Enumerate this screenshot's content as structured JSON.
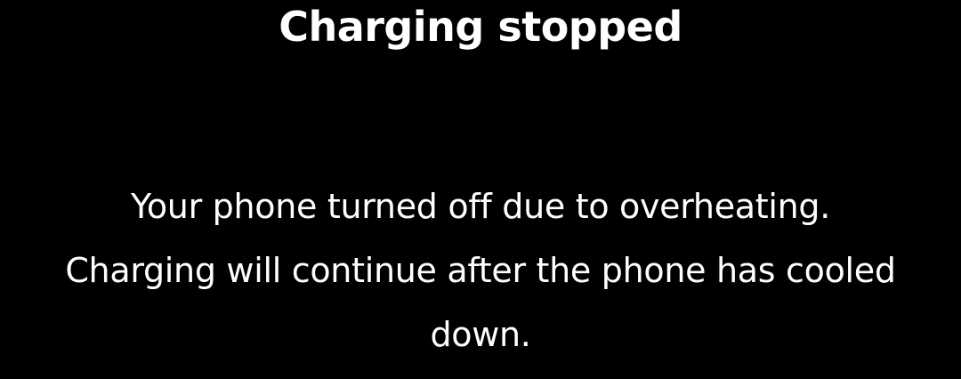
{
  "dialog": {
    "title": "Charging stopped",
    "message": "Your phone turned off due to overheating. Charging will continue after the phone has cooled down."
  }
}
